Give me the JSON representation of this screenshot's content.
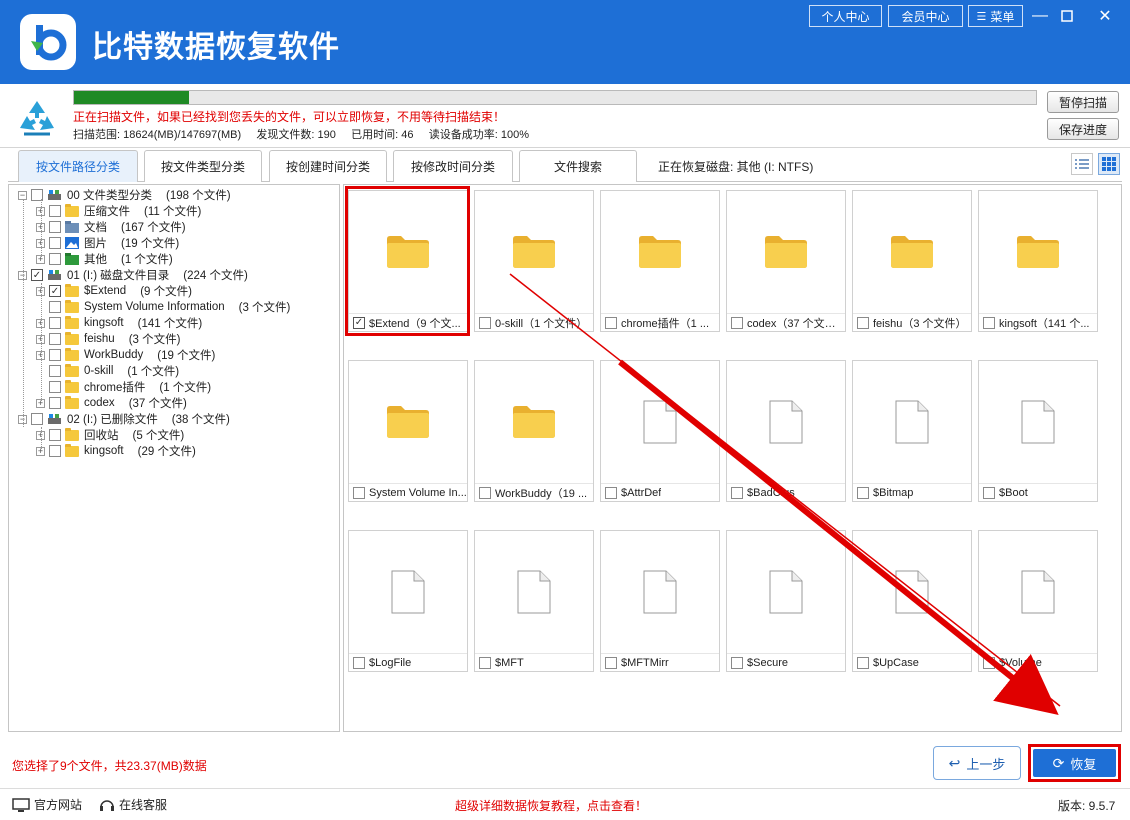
{
  "app": {
    "title": "比特数据恢复软件",
    "top_buttons": [
      "个人中心",
      "会员中心",
      "菜单"
    ]
  },
  "scan": {
    "progress": 0.12,
    "message": "正在扫描文件，如果已经找到您丢失的文件，可以立即恢复，不用等待扫描结束！",
    "stats": "扫描范围: 18624(MB)/147697(MB)     发现文件数: 190     已用时间: 46     读设备成功率: 100%",
    "pause_label": "暂停扫描",
    "save_label": "保存进度"
  },
  "tabs": [
    {
      "label": "按文件路径分类",
      "active": true
    },
    {
      "label": "按文件类型分类",
      "active": false
    },
    {
      "label": "按创建时间分类",
      "active": false
    },
    {
      "label": "按修改时间分类",
      "active": false
    },
    {
      "label": "文件搜索",
      "active": false
    }
  ],
  "disk_label": "正在恢复磁盘: 其他 (I: NTFS)",
  "tree": [
    {
      "level": 0,
      "label": "00 文件类型分类",
      "count": "(198 个文件)",
      "icon": "drive-icon",
      "expander": "−",
      "checked": false
    },
    {
      "level": 1,
      "label": "压缩文件",
      "count": "(11 个文件)",
      "icon": "archive-icon",
      "expander": "+",
      "checked": false
    },
    {
      "level": 1,
      "label": "文档",
      "count": "(167 个文件)",
      "icon": "document-icon",
      "expander": "+",
      "checked": false
    },
    {
      "level": 1,
      "label": "图片",
      "count": "(19 个文件)",
      "icon": "image-icon",
      "expander": "+",
      "checked": false
    },
    {
      "level": 1,
      "label": "其他",
      "count": "(1 个文件)",
      "icon": "other-icon",
      "expander": "+",
      "checked": false
    },
    {
      "level": 0,
      "label": "01 (I:) 磁盘文件目录",
      "count": "(224 个文件)",
      "icon": "drive-icon",
      "expander": "−",
      "checked": true
    },
    {
      "level": 1,
      "label": "$Extend",
      "count": "(9 个文件)",
      "icon": "folder-icon",
      "expander": "+",
      "checked": true
    },
    {
      "level": 1,
      "label": "System Volume Information",
      "count": "(3 个文件)",
      "icon": "folder-icon",
      "expander": "",
      "checked": false
    },
    {
      "level": 1,
      "label": "kingsoft",
      "count": "(141 个文件)",
      "icon": "folder-icon",
      "expander": "+",
      "checked": false
    },
    {
      "level": 1,
      "label": "feishu",
      "count": "(3 个文件)",
      "icon": "folder-icon",
      "expander": "+",
      "checked": false
    },
    {
      "level": 1,
      "label": "WorkBuddy",
      "count": "(19 个文件)",
      "icon": "folder-icon",
      "expander": "+",
      "checked": false
    },
    {
      "level": 1,
      "label": "0-skill",
      "count": "(1 个文件)",
      "icon": "folder-icon",
      "expander": "",
      "checked": false
    },
    {
      "level": 1,
      "label": "chrome插件",
      "count": "(1 个文件)",
      "icon": "folder-icon",
      "expander": "",
      "checked": false
    },
    {
      "level": 1,
      "label": "codex",
      "count": "(37 个文件)",
      "icon": "folder-icon",
      "expander": "+",
      "checked": false
    },
    {
      "level": 0,
      "label": "02 (I:) 已删除文件",
      "count": "(38 个文件)",
      "icon": "drive-icon",
      "expander": "−",
      "checked": false
    },
    {
      "level": 1,
      "label": "回收站",
      "count": "(5 个文件)",
      "icon": "folder-icon",
      "expander": "+",
      "checked": false
    },
    {
      "level": 1,
      "label": "kingsoft",
      "count": "(29 个文件)",
      "icon": "folder-icon",
      "expander": "+",
      "checked": false
    }
  ],
  "grid": [
    {
      "label": "$Extend（9 个文...",
      "type": "folder",
      "checked": true
    },
    {
      "label": "0-skill（1 个文件）",
      "type": "folder",
      "checked": false
    },
    {
      "label": "chrome插件（1 ...",
      "type": "folder",
      "checked": false
    },
    {
      "label": "codex（37 个文件）",
      "type": "folder",
      "checked": false
    },
    {
      "label": "feishu（3 个文件）",
      "type": "folder",
      "checked": false
    },
    {
      "label": "kingsoft（141 个...",
      "type": "folder",
      "checked": false
    },
    {
      "label": "System Volume In...",
      "type": "folder",
      "checked": false
    },
    {
      "label": "WorkBuddy（19 ...",
      "type": "folder",
      "checked": false
    },
    {
      "label": "$AttrDef",
      "type": "file",
      "checked": false
    },
    {
      "label": "$BadClus",
      "type": "file",
      "checked": false
    },
    {
      "label": "$Bitmap",
      "type": "file",
      "checked": false
    },
    {
      "label": "$Boot",
      "type": "file",
      "checked": false
    },
    {
      "label": "$LogFile",
      "type": "file",
      "checked": false
    },
    {
      "label": "$MFT",
      "type": "file",
      "checked": false
    },
    {
      "label": "$MFTMirr",
      "type": "file",
      "checked": false
    },
    {
      "label": "$Secure",
      "type": "file",
      "checked": false
    },
    {
      "label": "$UpCase",
      "type": "file",
      "checked": false
    },
    {
      "label": "$Volume",
      "type": "file",
      "checked": false
    }
  ],
  "bottom": {
    "selection_status": "您选择了9个文件，共23.37(MB)数据",
    "prev_label": "上一步",
    "recover_label": "恢复"
  },
  "footer": {
    "website": "官方网站",
    "support": "在线客服",
    "tutorial": "超级详细数据恢复教程，点击查看！",
    "version": "版本: 9.5.7"
  },
  "colors": {
    "brand_blue": "#1e6fd6",
    "alert_red": "#e00000",
    "progress_green": "#1f8a25",
    "folder_yellow": "#f5c83c"
  }
}
